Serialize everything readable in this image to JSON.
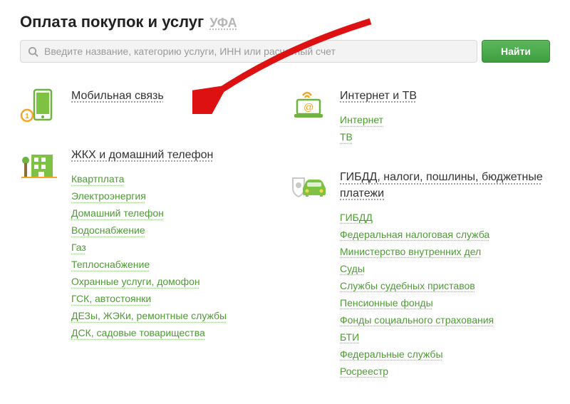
{
  "header": {
    "title": "Оплата покупок и услуг",
    "city": "УФА"
  },
  "search": {
    "placeholder": "Введите название, категорию услуги, ИНН или расчетный счет",
    "button": "Найти"
  },
  "left_col": [
    {
      "id": "mobile",
      "title": "Мобильная связь",
      "links": []
    },
    {
      "id": "zhkh",
      "title": "ЖКХ и домашний телефон",
      "links": [
        "Квартплата",
        "Электроэнергия",
        "Домашний телефон",
        "Водоснабжение",
        "Газ",
        "Теплоснабжение",
        "Охранные услуги, домофон",
        "ГСК, автостоянки",
        "ДЕЗы, ЖЭКи, ремонтные службы",
        "ДСК, садовые товарищества"
      ]
    }
  ],
  "right_col": [
    {
      "id": "internet",
      "title": "Интернет и ТВ",
      "links": [
        "Интернет",
        "ТВ"
      ]
    },
    {
      "id": "gibdd",
      "title": "ГИБДД, налоги, пошлины, бюджетные платежи",
      "links": [
        "ГИБДД",
        "Федеральная налоговая служба",
        "Министерство внутренних дел",
        "Суды",
        "Службы судебных приставов",
        "Пенсионные фонды",
        "Фонды социального страхования",
        "БТИ",
        "Федеральные службы",
        "Росреестр"
      ]
    }
  ]
}
